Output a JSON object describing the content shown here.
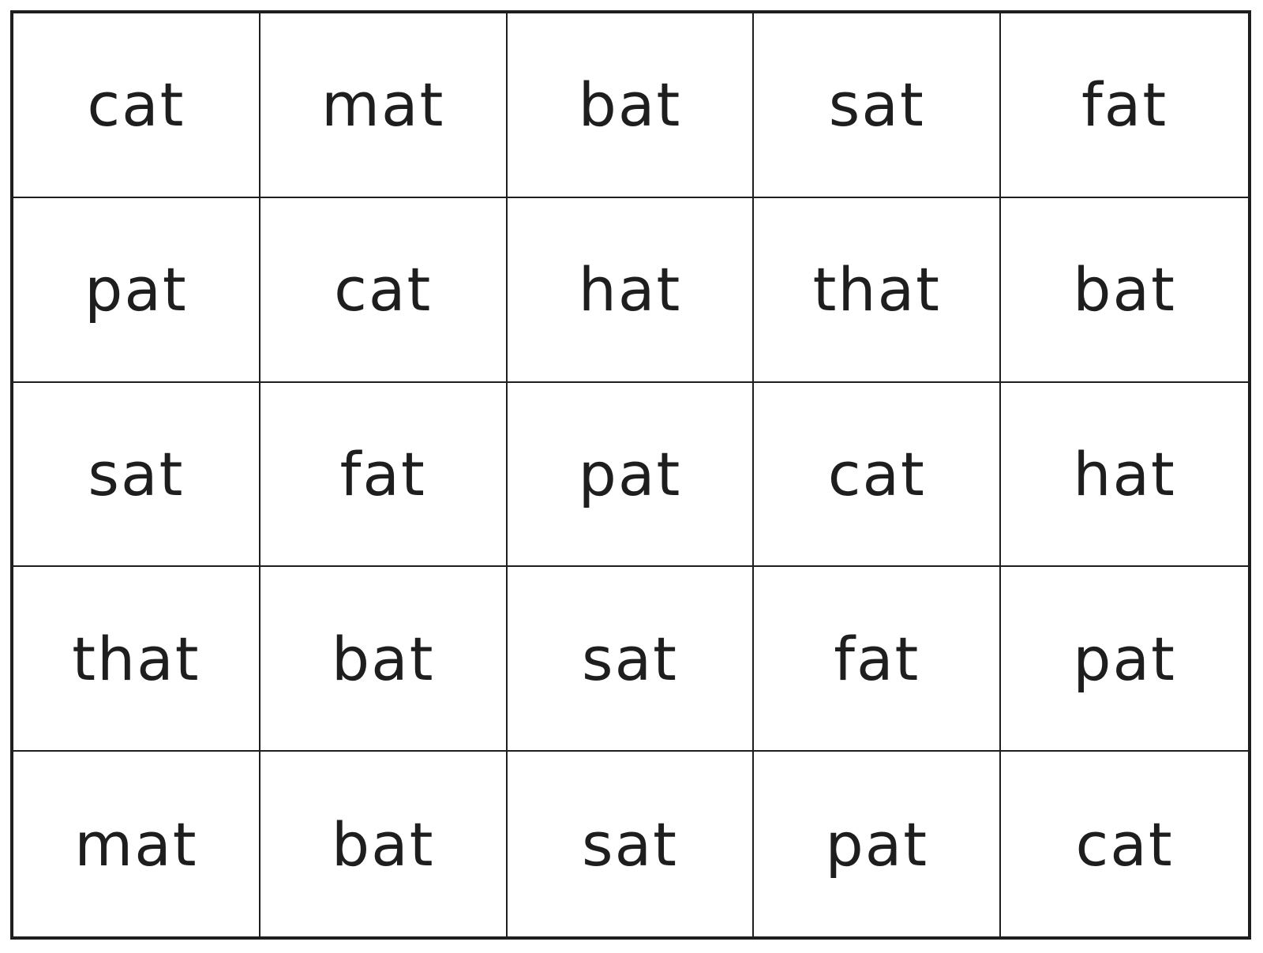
{
  "worksheet": {
    "rows": [
      [
        "cat",
        "mat",
        "bat",
        "sat",
        "fat"
      ],
      [
        "pat",
        "cat",
        "hat",
        "that",
        "bat"
      ],
      [
        "sat",
        "fat",
        "pat",
        "cat",
        "hat"
      ],
      [
        "that",
        "bat",
        "sat",
        "fat",
        "pat"
      ],
      [
        "mat",
        "bat",
        "sat",
        "pat",
        "cat"
      ]
    ]
  }
}
